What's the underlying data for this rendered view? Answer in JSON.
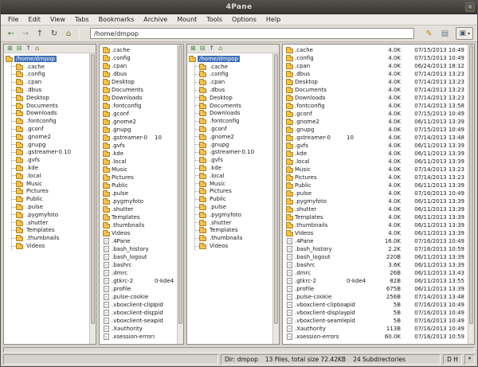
{
  "window": {
    "title": "4Pane",
    "close_icon": "✕"
  },
  "menu": {
    "items": [
      "File",
      "Edit",
      "View",
      "Tabs",
      "Bookmarks",
      "Archive",
      "Mount",
      "Tools",
      "Options",
      "Help"
    ]
  },
  "toolbar": {
    "path": "/home/dmpop",
    "left_icons": [
      {
        "name": "back-icon",
        "glyph": "←",
        "color": "#2e8b2e"
      },
      {
        "name": "forward-icon",
        "glyph": "→",
        "color": "#9b9b93"
      },
      {
        "name": "up-icon",
        "glyph": "↑",
        "color": "#44484f"
      },
      {
        "name": "refresh-icon",
        "glyph": "↻",
        "color": "#44484f"
      },
      {
        "name": "home-icon",
        "glyph": "⌂",
        "color": "#8a6d1a"
      }
    ],
    "right_icons": [
      {
        "name": "paintbrush-icon",
        "glyph": "✎",
        "color": "#b8860b"
      },
      {
        "name": "document-icon",
        "glyph": "▤",
        "color": "#6b7b8c"
      }
    ],
    "dropdown": {
      "label": "display-dropdown-button",
      "glyph": "▣",
      "arrow": "▾"
    }
  },
  "pane_toolbar": {
    "icons": [
      {
        "name": "expand-all-icon",
        "glyph": "⊞",
        "color": "#2e7d32"
      },
      {
        "name": "collapse-all-icon",
        "glyph": "⊟",
        "color": "#2e7d32"
      },
      {
        "name": "tree-up-icon",
        "glyph": "↑",
        "color": "#44484f"
      },
      {
        "name": "tree-home-icon",
        "glyph": "⌂",
        "color": "#8a6d1a"
      }
    ]
  },
  "tree": {
    "root": "/home/dmpop",
    "children": [
      ".cache",
      ".config",
      ".cpan",
      ".dbus",
      "Desktop",
      "Documents",
      "Downloads",
      ".fontconfig",
      ".gconf",
      ".gnome2",
      ".gnupg",
      ".gstreamer-0.10",
      ".gvfs",
      ".kde",
      ".local",
      "Music",
      "Pictures",
      "Public",
      ".pulse",
      ".pygmyfoto",
      ".shutter",
      "Templates",
      ".thumbnails",
      "Videos"
    ]
  },
  "files": [
    {
      "base": ".cache",
      "ext": "",
      "size": "4.0K",
      "date": "07/15/2013 10:49",
      "kind": "dir"
    },
    {
      "base": ".config",
      "ext": "",
      "size": "4.0K",
      "date": "07/15/2013 10:49",
      "kind": "dir"
    },
    {
      "base": ".cpan",
      "ext": "",
      "size": "4.0K",
      "date": "06/24/2013 18:12",
      "kind": "dir"
    },
    {
      "base": ".dbus",
      "ext": "",
      "size": "4.0K",
      "date": "07/14/2013 13:23",
      "kind": "dir"
    },
    {
      "base": "Desktop",
      "ext": "",
      "size": "4.0K",
      "date": "07/14/2013 13:23",
      "kind": "dir"
    },
    {
      "base": "Documents",
      "ext": "",
      "size": "4.0K",
      "date": "07/14/2013 13:23",
      "kind": "dir"
    },
    {
      "base": "Downloads",
      "ext": "",
      "size": "4.0K",
      "date": "07/14/2013 13:23",
      "kind": "dir"
    },
    {
      "base": ".fontconfig",
      "ext": "",
      "size": "4.0K",
      "date": "07/14/2013 13:58",
      "kind": "dir"
    },
    {
      "base": ".gconf",
      "ext": "",
      "size": "4.0K",
      "date": "07/15/2013 10:49",
      "kind": "dir"
    },
    {
      "base": ".gnome2",
      "ext": "",
      "size": "4.0K",
      "date": "06/11/2013 13:39",
      "kind": "dir"
    },
    {
      "base": ".gnupg",
      "ext": "",
      "size": "4.0K",
      "date": "07/15/2013 10:49",
      "kind": "dir"
    },
    {
      "base": ".gstreamer-0",
      "ext": "10",
      "size": "4.0K",
      "date": "07/14/2013 13:48",
      "kind": "dir"
    },
    {
      "base": ".gvfs",
      "ext": "",
      "size": "4.0K",
      "date": "06/11/2013 13:39",
      "kind": "dir"
    },
    {
      "base": ".kde",
      "ext": "",
      "size": "4.0K",
      "date": "06/11/2013 13:39",
      "kind": "dir"
    },
    {
      "base": ".local",
      "ext": "",
      "size": "4.0K",
      "date": "06/11/2013 13:39",
      "kind": "dir"
    },
    {
      "base": "Music",
      "ext": "",
      "size": "4.0K",
      "date": "07/14/2013 13:23",
      "kind": "dir"
    },
    {
      "base": "Pictures",
      "ext": "",
      "size": "4.0K",
      "date": "07/14/2013 13:23",
      "kind": "dir"
    },
    {
      "base": "Public",
      "ext": "",
      "size": "4.0K",
      "date": "06/11/2013 13:39",
      "kind": "dir"
    },
    {
      "base": ".pulse",
      "ext": "",
      "size": "4.0K",
      "date": "07/16/2013 10:49",
      "kind": "dir"
    },
    {
      "base": ".pygmyfoto",
      "ext": "",
      "size": "4.0K",
      "date": "06/11/2013 13:39",
      "kind": "dir"
    },
    {
      "base": ".shutter",
      "ext": "",
      "size": "4.0K",
      "date": "06/11/2013 13:39",
      "kind": "dir"
    },
    {
      "base": "Templates",
      "ext": "",
      "size": "4.0K",
      "date": "06/11/2013 13:39",
      "kind": "dir"
    },
    {
      "base": ".thumbnails",
      "ext": "",
      "size": "4.0K",
      "date": "06/11/2013 13:39",
      "kind": "dir"
    },
    {
      "base": "Videos",
      "ext": "",
      "size": "4.0K",
      "date": "06/11/2013 13:39",
      "kind": "dir"
    },
    {
      "base": ".4Pane",
      "ext": "",
      "size": "16.0K",
      "date": "07/16/2013 10:49",
      "kind": "file"
    },
    {
      "base": ".bash_history",
      "ext": "",
      "size": "2.2K",
      "date": "07/16/2013 10:59",
      "kind": "file"
    },
    {
      "base": ".bash_logout",
      "ext": "",
      "size": "220B",
      "date": "06/11/2013 13:39",
      "kind": "file"
    },
    {
      "base": ".bashrc",
      "ext": "",
      "size": "3.6K",
      "date": "06/11/2013 13:39",
      "kind": "file"
    },
    {
      "base": ".dmrc",
      "ext": "",
      "size": "26B",
      "date": "06/11/2013 13:43",
      "kind": "file"
    },
    {
      "base": ".gtkrc-2",
      "ext": "0-kde4",
      "size": "82B",
      "date": "06/11/2013 13:55",
      "kind": "file"
    },
    {
      "base": ".profile",
      "ext": "",
      "size": "675B",
      "date": "06/11/2013 13:39",
      "kind": "file"
    },
    {
      "base": ".pulse-cookie",
      "ext": "",
      "size": "256B",
      "date": "07/14/2013 13:48",
      "kind": "file"
    },
    {
      "base": ".vboxclient-clipboard",
      "ext": "pid",
      "size": "5B",
      "date": "07/16/2013 10:49",
      "kind": "file"
    },
    {
      "base": ".vboxclient-display",
      "ext": "pid",
      "size": "5B",
      "date": "07/16/2013 10:49",
      "kind": "file"
    },
    {
      "base": ".vboxclient-seamless",
      "ext": "pid",
      "size": "5B",
      "date": "07/16/2013 10:49",
      "kind": "file"
    },
    {
      "base": ".Xauthority",
      "ext": "",
      "size": "113B",
      "date": "07/16/2013 10:49",
      "kind": "file"
    },
    {
      "base": ".xsession-errors",
      "ext": "",
      "size": "60.0K",
      "date": "07/16/2013 10:59",
      "kind": "file"
    }
  ],
  "statusbar": {
    "dir": "Dir: dmpop",
    "files": "13 Files, total size 72.42KB",
    "subdirs": "24 Subdirectories",
    "flags": "D H",
    "star": "*"
  }
}
